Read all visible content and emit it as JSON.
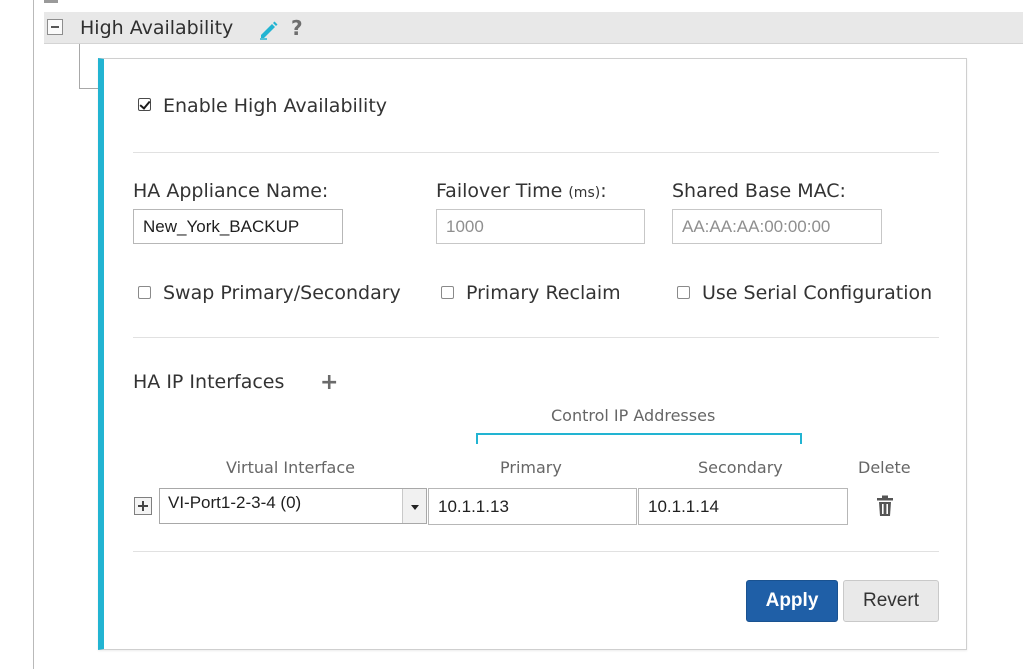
{
  "header": {
    "title": "High Availability",
    "help_glyph": "?",
    "icons": [
      "edit-icon",
      "help-icon",
      "collapse-icon"
    ]
  },
  "colors": {
    "accent": "#22b4d2",
    "primary_button": "#1f5fa7",
    "header_bg": "#e8e8e8"
  },
  "form": {
    "enable_ha": {
      "label": "Enable High Availability",
      "checked": true
    },
    "appliance_name": {
      "label": "HA Appliance Name:",
      "value": "New_York_BACKUP"
    },
    "failover_time": {
      "label": "Failover Time",
      "unit": "(ms)",
      "label_suffix": ":",
      "placeholder": "1000"
    },
    "shared_mac": {
      "label": "Shared Base MAC:",
      "placeholder": "AA:AA:AA:00:00:00"
    },
    "options": {
      "swap": {
        "label": "Swap Primary/Secondary",
        "checked": false
      },
      "reclaim": {
        "label": "Primary Reclaim",
        "checked": false
      },
      "serial": {
        "label": "Use Serial Configuration",
        "checked": false
      }
    }
  },
  "interfaces": {
    "title": "HA IP Interfaces",
    "add_glyph": "+",
    "group_header": "Control IP Addresses",
    "columns": {
      "virtual_interface": "Virtual Interface",
      "primary": "Primary",
      "secondary": "Secondary",
      "delete": "Delete"
    },
    "rows": [
      {
        "virtual_interface": "VI-Port1-2-3-4 (0)",
        "primary": "10.1.1.13",
        "secondary": "10.1.1.14"
      }
    ]
  },
  "actions": {
    "apply": "Apply",
    "revert": "Revert"
  }
}
